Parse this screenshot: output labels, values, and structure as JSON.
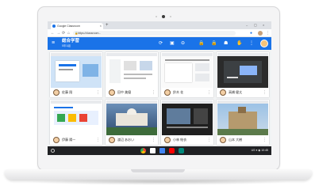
{
  "colors": {
    "accent": "#1a73e8",
    "shelf": "#202124",
    "lid": "#f4f4f5"
  },
  "browser": {
    "tab_title": "Google Classroom",
    "tab_close_icon": "close-icon",
    "new_tab_symbol": "+",
    "window_controls": {
      "minimize": "–",
      "restore": "▢",
      "close": "×"
    },
    "url": "https://classroom...",
    "back_icon": "←",
    "forward_icon": "→",
    "reload_icon": "⟳",
    "home_icon": "⌂",
    "menu_icon": "⋮"
  },
  "appbar": {
    "menu_icon": "≡",
    "title": "総合学習",
    "subtitle": "5年1組",
    "icons": [
      "⟳",
      "▣",
      "⊖",
      "🔒",
      "🔒",
      "☗",
      "✋",
      "⋮"
    ]
  },
  "students": [
    {
      "name": "佐藤 翔"
    },
    {
      "name": "田中 美優"
    },
    {
      "name": "鈴木 花"
    },
    {
      "name": "高橋 健太"
    },
    {
      "name": "伊藤 陽一"
    },
    {
      "name": "渡辺 あおい"
    },
    {
      "name": "小林 結衣"
    },
    {
      "name": "山本 大樹"
    }
  ],
  "card_menu_icon": "⋮",
  "shelf": {
    "apps": [
      "chrome-icon",
      "gmail-icon",
      "docs-icon",
      "youtube-icon",
      "meet-icon"
    ],
    "status": "US ▾ ◉ 10:45"
  }
}
